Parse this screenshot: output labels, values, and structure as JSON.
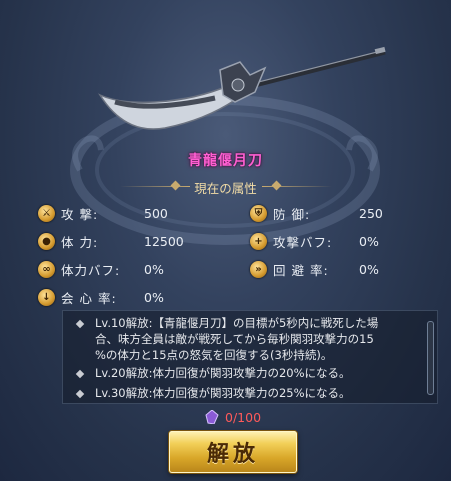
{
  "weapon": {
    "name": "青龍偃月刀"
  },
  "attributes_title": "現在の属性",
  "stats": [
    {
      "label": "攻 撃:",
      "value": "500",
      "icon": "sword-icon"
    },
    {
      "label": "防 御:",
      "value": "250",
      "icon": "shield-icon"
    },
    {
      "label": "体 力:",
      "value": "12500",
      "icon": "drop-icon"
    },
    {
      "label": "攻撃バフ:",
      "value": "0%",
      "icon": "sword-buff-icon"
    },
    {
      "label": "体力バフ:",
      "value": "0%",
      "icon": "drop-buff-icon"
    },
    {
      "label": "回 避 率:",
      "value": "0%",
      "icon": "evade-icon"
    },
    {
      "label": "会 心 率:",
      "value": "0%",
      "icon": "critical-icon"
    }
  ],
  "unlock_descriptions": [
    "Lv.10解放:【青龍偃月刀】の目標が5秒内に戦死した場",
    "合、味方全員は敵が戦死してから毎秒関羽攻撃力の15",
    "%の体力と15点の怒気を回復する(3秒持続)。",
    "Lv.20解放:体力回復が関羽攻撃力の20%になる。",
    "Lv.30解放:体力回復が関羽攻撃力の25%になる。"
  ],
  "cost": {
    "text": "0/100",
    "icon": "gem-icon"
  },
  "unlock_button": {
    "label": "解放"
  },
  "colors": {
    "name": "#ff5fd2",
    "cost": "#ff5a5a",
    "button": "#e8b83a",
    "gold": "#c8aa6e"
  }
}
